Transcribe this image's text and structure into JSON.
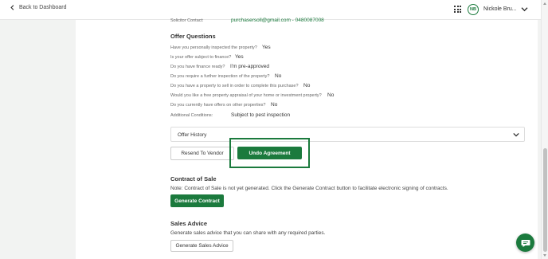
{
  "header": {
    "back_label": "Back to Dashboard",
    "avatar_initials": "NB",
    "user_name": "Nickole Bru..."
  },
  "solicitor": {
    "label": "Solicitor Contact:",
    "value": "purchasersoll@gmail.com - 0480087008"
  },
  "offer_questions": {
    "title": "Offer Questions",
    "items": [
      {
        "question": "Have you personally inspected the property?",
        "answer": "Yes"
      },
      {
        "question": "Is your offer subject to finance?",
        "answer": "Yes"
      },
      {
        "question": "Do you have finance ready?",
        "answer": "I'm pre-approved"
      },
      {
        "question": "Do you require a further inspection of the property?",
        "answer": "No"
      },
      {
        "question": "Do you have a property to sell in order to complete this purchase?",
        "answer": "No"
      },
      {
        "question": "Would you like a free property appraisal of your home or investment property?",
        "answer": "No"
      },
      {
        "question": "Do you currently have offers on other properties?",
        "answer": "No"
      },
      {
        "question": "Additional Conditions:",
        "answer": "Subject to pest inspection"
      }
    ]
  },
  "offer_history": {
    "label": "Offer History"
  },
  "actions": {
    "resend_label": "Resend To Vendor",
    "undo_label": "Undo Agreement"
  },
  "contract": {
    "title": "Contract of Sale",
    "note": "Note: Contract of Sale is not yet generated. Click the Generate Contract button to facilitate electronic signing of contracts.",
    "button_label": "Generate Contract"
  },
  "sales_advice": {
    "title": "Sales Advice",
    "description": "Generate sales advice that you can share with any required parties.",
    "button_label": "Generate Sales Advice"
  },
  "colors": {
    "accent": "#1b7a3d",
    "background": "#f2f3f2"
  }
}
